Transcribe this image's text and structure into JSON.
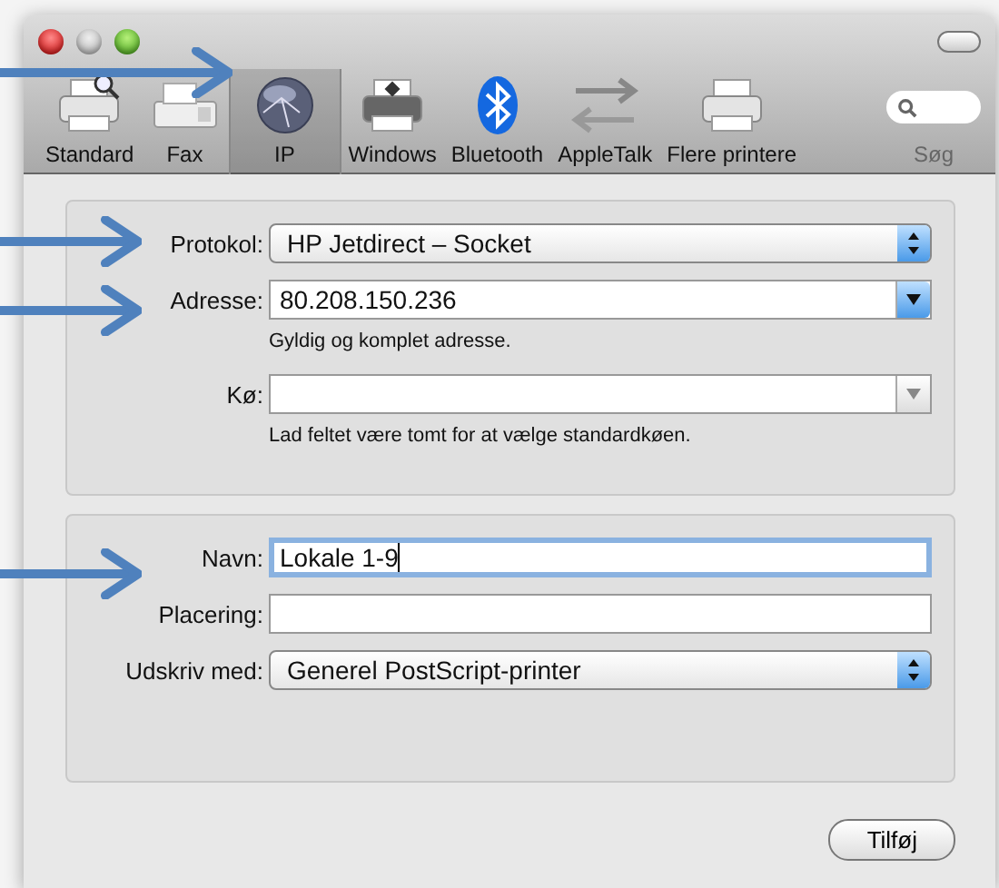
{
  "toolbar": {
    "items": [
      {
        "label": "Standard",
        "kind": "printer-search",
        "selected": false
      },
      {
        "label": "Fax",
        "kind": "fax",
        "selected": false
      },
      {
        "label": "IP",
        "kind": "globe",
        "selected": true
      },
      {
        "label": "Windows",
        "kind": "printer-windows",
        "selected": false
      },
      {
        "label": "Bluetooth",
        "kind": "bluetooth",
        "selected": false
      },
      {
        "label": "AppleTalk",
        "kind": "arrows",
        "selected": false
      },
      {
        "label": "Flere printere",
        "kind": "printer",
        "selected": false
      }
    ],
    "search": {
      "label": "Søg"
    }
  },
  "sections": [
    {
      "fields": [
        {
          "label": "Protokol:",
          "kind": "popup",
          "value": "HP Jetdirect – Socket"
        },
        {
          "label": "Adresse:",
          "kind": "combo",
          "value": "80.208.150.236",
          "hint": "Gyldig og komplet adresse."
        },
        {
          "label": "Kø:",
          "kind": "combo-plain",
          "hint": "Lad feltet være tomt for at vælge standardkøen."
        }
      ]
    },
    {
      "fields": [
        {
          "label": "Navn:",
          "kind": "text",
          "value": "Lokale 1-9",
          "focused": true
        },
        {
          "label": "Placering:",
          "kind": "text",
          "focused": false
        },
        {
          "label": "Udskriv med:",
          "kind": "popup",
          "value": "Generel PostScript-printer"
        }
      ]
    }
  ],
  "buttons": [
    {
      "label": "Tilføj"
    }
  ]
}
